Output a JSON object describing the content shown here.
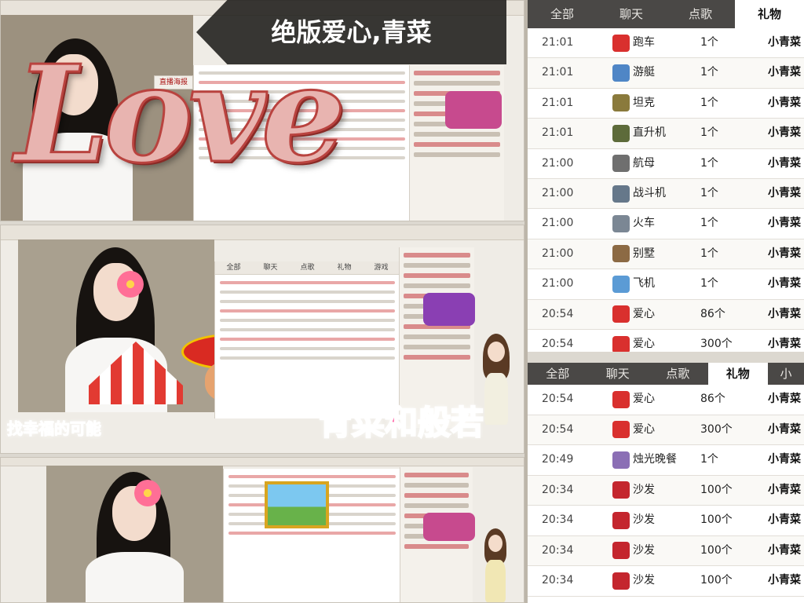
{
  "banner": {
    "title": "绝版爱心,青菜"
  },
  "overlay": {
    "love_word": "Love",
    "names": "青菜和般若",
    "caption": "找幸福的可能"
  },
  "panel_buttons": {
    "post": "直播海报"
  },
  "gift_list_1": {
    "tabs": [
      "全部",
      "聊天",
      "点歌",
      "礼物"
    ],
    "active_tab": "礼物",
    "rows": [
      {
        "time": "21:01",
        "icon": "car-icon",
        "gift": "跑车",
        "count": "1个",
        "user": "小青菜",
        "color": "#d9302e"
      },
      {
        "time": "21:01",
        "icon": "yacht-icon",
        "gift": "游艇",
        "count": "1个",
        "user": "小青菜",
        "color": "#4f86c6"
      },
      {
        "time": "21:01",
        "icon": "tank-icon",
        "gift": "坦克",
        "count": "1个",
        "user": "小青菜",
        "color": "#8a7a3c"
      },
      {
        "time": "21:01",
        "icon": "helicopter-icon",
        "gift": "直升机",
        "count": "1个",
        "user": "小青菜",
        "color": "#5d6b3a"
      },
      {
        "time": "21:00",
        "icon": "carrier-icon",
        "gift": "航母",
        "count": "1个",
        "user": "小青菜",
        "color": "#6f6f6f"
      },
      {
        "time": "21:00",
        "icon": "fighter-icon",
        "gift": "战斗机",
        "count": "1个",
        "user": "小青菜",
        "color": "#66788a"
      },
      {
        "time": "21:00",
        "icon": "train-icon",
        "gift": "火车",
        "count": "1个",
        "user": "小青菜",
        "color": "#7b8794"
      },
      {
        "time": "21:00",
        "icon": "villa-icon",
        "gift": "别墅",
        "count": "1个",
        "user": "小青菜",
        "color": "#8c6a44"
      },
      {
        "time": "21:00",
        "icon": "plane-icon",
        "gift": "飞机",
        "count": "1个",
        "user": "小青菜",
        "color": "#5b9bd5"
      },
      {
        "time": "20:54",
        "icon": "heart-icon",
        "gift": "爱心",
        "count": "86个",
        "user": "小青菜",
        "color": "#d9302e"
      },
      {
        "time": "20:54",
        "icon": "heart-icon",
        "gift": "爱心",
        "count": "300个",
        "user": "小青菜",
        "color": "#d9302e"
      }
    ]
  },
  "gift_list_2": {
    "tabs": [
      "全部",
      "聊天",
      "点歌",
      "礼物",
      "小"
    ],
    "active_tab": "礼物",
    "rows": [
      {
        "time": "20:54",
        "icon": "heart-icon",
        "gift": "爱心",
        "count": "86个",
        "user": "小青菜",
        "color": "#d9302e"
      },
      {
        "time": "20:54",
        "icon": "heart-icon",
        "gift": "爱心",
        "count": "300个",
        "user": "小青菜",
        "color": "#d9302e"
      },
      {
        "time": "20:49",
        "icon": "dinner-icon",
        "gift": "烛光晚餐",
        "count": "1个",
        "user": "小青菜",
        "color": "#8b6fb5"
      },
      {
        "time": "20:34",
        "icon": "sofa-icon",
        "gift": "沙发",
        "count": "100个",
        "user": "小青菜",
        "color": "#c4262e"
      },
      {
        "time": "20:34",
        "icon": "sofa-icon",
        "gift": "沙发",
        "count": "100个",
        "user": "小青菜",
        "color": "#c4262e"
      },
      {
        "time": "20:34",
        "icon": "sofa-icon",
        "gift": "沙发",
        "count": "100个",
        "user": "小青菜",
        "color": "#c4262e"
      },
      {
        "time": "20:34",
        "icon": "sofa-icon",
        "gift": "沙发",
        "count": "100个",
        "user": "小青菜",
        "color": "#c4262e"
      }
    ]
  },
  "colors": {
    "accent": "#ff5aa0",
    "tabbar": "#4a4846",
    "banner_bg": "#1e1c1a"
  }
}
